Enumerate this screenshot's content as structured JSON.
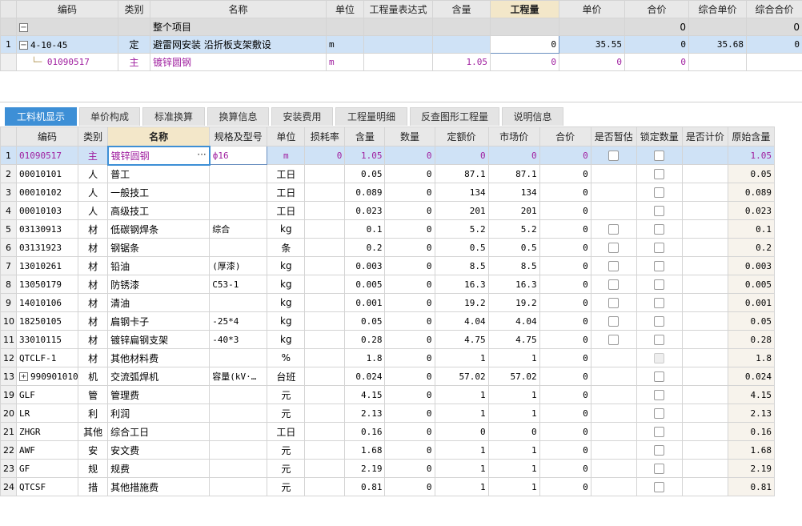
{
  "top_grid": {
    "headers": [
      "编码",
      "类别",
      "名称",
      "单位",
      "工程量表达式",
      "含量",
      "工程量",
      "单价",
      "合价",
      "综合单价",
      "综合合价"
    ],
    "group_row": {
      "name": "整个项目",
      "total1": "0",
      "total2": "0"
    },
    "rows": [
      {
        "num": "1",
        "code": "4-10-45",
        "type": "定",
        "name": "避雷网安装 沿折板支架敷设",
        "unit": "m",
        "expr": "",
        "content": "",
        "qty": "0",
        "price": "35.55",
        "total": "0",
        "comp_price": "35.68",
        "comp_total": "0"
      },
      {
        "num": "",
        "code": "01090517",
        "type": "主",
        "name": "镀锌圆钢",
        "unit": "m",
        "expr": "",
        "content": "1.05",
        "qty": "0",
        "price": "0",
        "total": "0",
        "comp_price": "",
        "comp_total": ""
      }
    ]
  },
  "tabs": [
    "工料机显示",
    "单价构成",
    "标准换算",
    "换算信息",
    "安装费用",
    "工程量明细",
    "反查图形工程量",
    "说明信息"
  ],
  "bottom_grid": {
    "headers": [
      "编码",
      "类别",
      "名称",
      "规格及型号",
      "单位",
      "损耗率",
      "含量",
      "数量",
      "定额价",
      "市场价",
      "合价",
      "是否暂估",
      "锁定数量",
      "是否计价",
      "原始含量"
    ],
    "rows": [
      {
        "num": "1",
        "code": "01090517",
        "type": "主",
        "name": "镀锌圆钢",
        "spec": "ф16",
        "unit": "m",
        "loss": "0",
        "content": "1.05",
        "qty": "0",
        "quota": "0",
        "market": "0",
        "total": "0",
        "est": true,
        "lock": true,
        "orig": "1.05"
      },
      {
        "num": "2",
        "code": "00010101",
        "type": "人",
        "name": "普工",
        "spec": "",
        "unit": "工日",
        "loss": "",
        "content": "0.05",
        "qty": "0",
        "quota": "87.1",
        "market": "87.1",
        "total": "0",
        "est": false,
        "lock": true,
        "orig": "0.05"
      },
      {
        "num": "3",
        "code": "00010102",
        "type": "人",
        "name": "一般技工",
        "spec": "",
        "unit": "工日",
        "loss": "",
        "content": "0.089",
        "qty": "0",
        "quota": "134",
        "market": "134",
        "total": "0",
        "est": false,
        "lock": true,
        "orig": "0.089"
      },
      {
        "num": "4",
        "code": "00010103",
        "type": "人",
        "name": "高级技工",
        "spec": "",
        "unit": "工日",
        "loss": "",
        "content": "0.023",
        "qty": "0",
        "quota": "201",
        "market": "201",
        "total": "0",
        "est": false,
        "lock": true,
        "orig": "0.023"
      },
      {
        "num": "5",
        "code": "03130913",
        "type": "材",
        "name": "低碳钢焊条",
        "spec": "综合",
        "unit": "kg",
        "loss": "",
        "content": "0.1",
        "qty": "0",
        "quota": "5.2",
        "market": "5.2",
        "total": "0",
        "est": true,
        "lock": true,
        "orig": "0.1"
      },
      {
        "num": "6",
        "code": "03131923",
        "type": "材",
        "name": "钢锯条",
        "spec": "",
        "unit": "条",
        "loss": "",
        "content": "0.2",
        "qty": "0",
        "quota": "0.5",
        "market": "0.5",
        "total": "0",
        "est": true,
        "lock": true,
        "orig": "0.2"
      },
      {
        "num": "7",
        "code": "13010261",
        "type": "材",
        "name": "铅油",
        "spec": "(厚漆)",
        "unit": "kg",
        "loss": "",
        "content": "0.003",
        "qty": "0",
        "quota": "8.5",
        "market": "8.5",
        "total": "0",
        "est": true,
        "lock": true,
        "orig": "0.003"
      },
      {
        "num": "8",
        "code": "13050179",
        "type": "材",
        "name": "防锈漆",
        "spec": "C53-1",
        "unit": "kg",
        "loss": "",
        "content": "0.005",
        "qty": "0",
        "quota": "16.3",
        "market": "16.3",
        "total": "0",
        "est": true,
        "lock": true,
        "orig": "0.005"
      },
      {
        "num": "9",
        "code": "14010106",
        "type": "材",
        "name": "清油",
        "spec": "",
        "unit": "kg",
        "loss": "",
        "content": "0.001",
        "qty": "0",
        "quota": "19.2",
        "market": "19.2",
        "total": "0",
        "est": true,
        "lock": true,
        "orig": "0.001"
      },
      {
        "num": "10",
        "code": "18250105",
        "type": "材",
        "name": "扁钢卡子",
        "spec": "-25*4",
        "unit": "kg",
        "loss": "",
        "content": "0.05",
        "qty": "0",
        "quota": "4.04",
        "market": "4.04",
        "total": "0",
        "est": true,
        "lock": true,
        "orig": "0.05"
      },
      {
        "num": "11",
        "code": "33010115",
        "type": "材",
        "name": "镀锌扁钢支架",
        "spec": "-40*3",
        "unit": "kg",
        "loss": "",
        "content": "0.28",
        "qty": "0",
        "quota": "4.75",
        "market": "4.75",
        "total": "0",
        "est": true,
        "lock": true,
        "orig": "0.28"
      },
      {
        "num": "12",
        "code": "QTCLF-1",
        "type": "材",
        "name": "其他材料费",
        "spec": "",
        "unit": "%",
        "loss": "",
        "content": "1.8",
        "qty": "0",
        "quota": "1",
        "market": "1",
        "total": "0",
        "est": false,
        "lock": "disabled",
        "orig": "1.8"
      },
      {
        "num": "13",
        "code": "990901010",
        "type": "机",
        "name": "交流弧焊机",
        "spec": "容量(kV·…",
        "unit": "台班",
        "loss": "",
        "content": "0.024",
        "qty": "0",
        "quota": "57.02",
        "market": "57.02",
        "total": "0",
        "est": false,
        "lock": true,
        "orig": "0.024",
        "expand": true
      },
      {
        "num": "19",
        "code": "GLF",
        "type": "管",
        "name": "管理费",
        "spec": "",
        "unit": "元",
        "loss": "",
        "content": "4.15",
        "qty": "0",
        "quota": "1",
        "market": "1",
        "total": "0",
        "est": false,
        "lock": true,
        "orig": "4.15"
      },
      {
        "num": "20",
        "code": "LR",
        "type": "利",
        "name": "利润",
        "spec": "",
        "unit": "元",
        "loss": "",
        "content": "2.13",
        "qty": "0",
        "quota": "1",
        "market": "1",
        "total": "0",
        "est": false,
        "lock": true,
        "orig": "2.13"
      },
      {
        "num": "21",
        "code": "ZHGR",
        "type": "其他",
        "name": "综合工日",
        "spec": "",
        "unit": "工日",
        "loss": "",
        "content": "0.16",
        "qty": "0",
        "quota": "0",
        "market": "0",
        "total": "0",
        "est": false,
        "lock": true,
        "orig": "0.16"
      },
      {
        "num": "22",
        "code": "AWF",
        "type": "安",
        "name": "安文费",
        "spec": "",
        "unit": "元",
        "loss": "",
        "content": "1.68",
        "qty": "0",
        "quota": "1",
        "market": "1",
        "total": "0",
        "est": false,
        "lock": true,
        "orig": "1.68"
      },
      {
        "num": "23",
        "code": "GF",
        "type": "规",
        "name": "规费",
        "spec": "",
        "unit": "元",
        "loss": "",
        "content": "2.19",
        "qty": "0",
        "quota": "1",
        "market": "1",
        "total": "0",
        "est": false,
        "lock": true,
        "orig": "2.19"
      },
      {
        "num": "24",
        "code": "QTCSF",
        "type": "措",
        "name": "其他措施费",
        "spec": "",
        "unit": "元",
        "loss": "",
        "content": "0.81",
        "qty": "0",
        "quota": "1",
        "market": "1",
        "total": "0",
        "est": false,
        "lock": true,
        "orig": "0.81"
      }
    ]
  },
  "icons": {
    "expand": "+",
    "collapse": "−",
    "more": "···"
  },
  "colors": {
    "accent": "#3d8fd6",
    "selected_row": "#cfe2f6",
    "purple_text": "#a020a0",
    "sort_header": "#f3e7c9"
  }
}
